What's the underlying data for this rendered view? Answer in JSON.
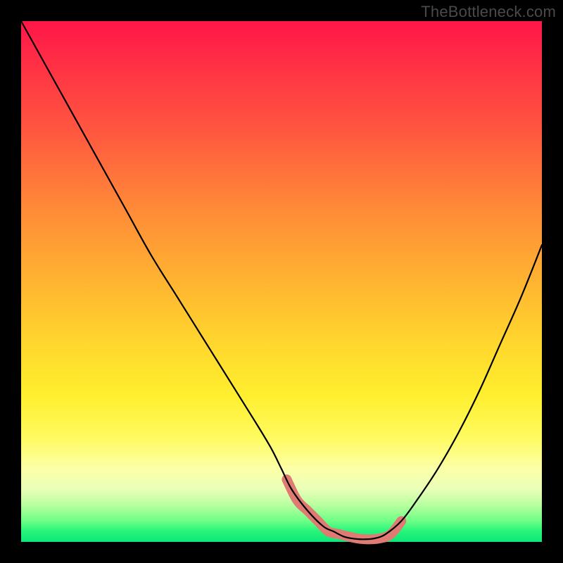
{
  "watermark": "TheBottleneck.com",
  "chart_data": {
    "type": "line",
    "title": "",
    "xlabel": "",
    "ylabel": "",
    "xlim": [
      0,
      100
    ],
    "ylim": [
      0,
      100
    ],
    "grid": false,
    "legend": false,
    "background_gradient": {
      "orientation": "vertical",
      "stops": [
        {
          "pos": 0.0,
          "color": "#ff1648"
        },
        {
          "pos": 0.5,
          "color": "#ffb431"
        },
        {
          "pos": 0.8,
          "color": "#fffb60"
        },
        {
          "pos": 1.0,
          "color": "#0be877"
        }
      ]
    },
    "series": [
      {
        "name": "bottleneck-curve",
        "stroke": "#000000",
        "x": [
          0,
          5,
          10,
          15,
          20,
          25,
          30,
          35,
          40,
          45,
          48,
          50,
          52,
          55,
          58,
          60,
          62,
          64,
          66,
          68,
          70,
          73,
          76,
          80,
          84,
          88,
          92,
          96,
          100
        ],
        "y": [
          100,
          91,
          82,
          73,
          64,
          55,
          47,
          39,
          31,
          23,
          18,
          14,
          10,
          6,
          3,
          2,
          1,
          0.6,
          0.5,
          0.7,
          1.5,
          4,
          8,
          14,
          21,
          29,
          38,
          47,
          57
        ]
      }
    ],
    "annotations": [
      {
        "name": "valley-highlight",
        "type": "polyline",
        "stroke": "#e07b74",
        "stroke_width": 10,
        "x": [
          51,
          53,
          55,
          57,
          59,
          61,
          63,
          65,
          67,
          69,
          71,
          73
        ],
        "y": [
          12,
          8,
          6,
          4,
          2,
          1.5,
          1,
          0.6,
          0.5,
          0.7,
          1.5,
          4
        ],
        "end_dot": {
          "x": 73,
          "y": 4,
          "r": 6,
          "fill": "#e07b74"
        }
      }
    ]
  }
}
